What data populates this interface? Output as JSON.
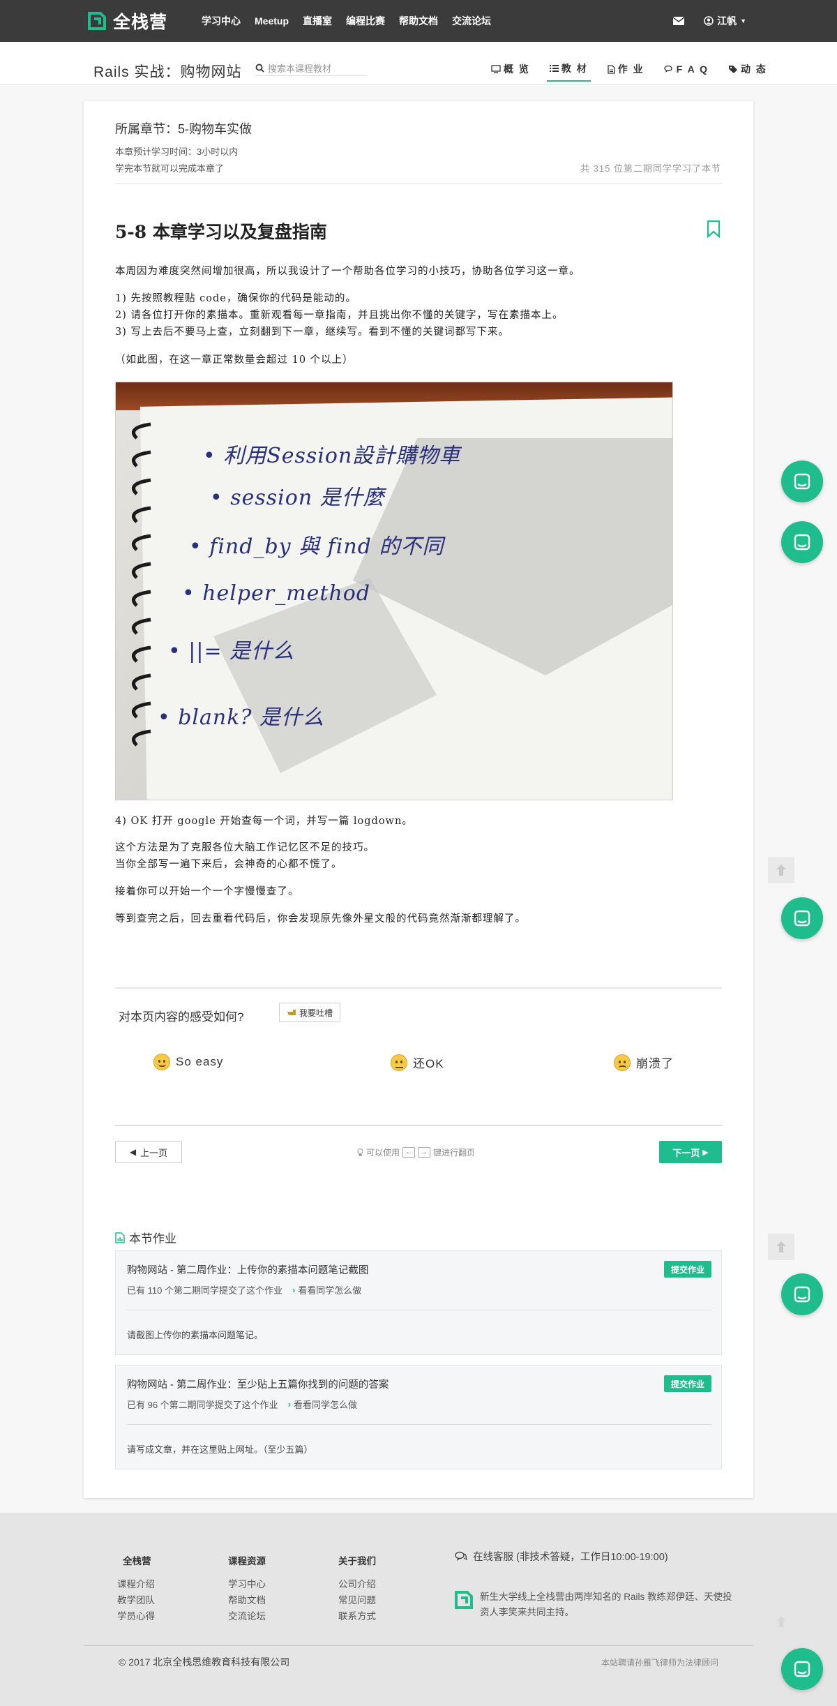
{
  "topbar": {
    "brand": "全栈营",
    "nav": [
      "学习中心",
      "Meetup",
      "直播室",
      "编程比赛",
      "帮助文档",
      "交流论坛"
    ],
    "user": "江帆"
  },
  "subbar": {
    "course_title": "Rails 实战：购物网站",
    "search_placeholder": "搜索本课程教材",
    "tabs": [
      {
        "label": "概 览",
        "icon": "monitor-icon",
        "active": false
      },
      {
        "label": "教 材",
        "icon": "list-icon",
        "active": true
      },
      {
        "label": "作 业",
        "icon": "file-icon",
        "active": false
      },
      {
        "label": "F A Q",
        "icon": "comments-icon",
        "active": false
      },
      {
        "label": "动 态",
        "icon": "tags-icon",
        "active": false
      }
    ]
  },
  "lesson": {
    "chapter": "所属章节：5-购物车实做",
    "estimate": "本章预计学习时间：3小时以内",
    "complete": "学完本节就可以完成本章了",
    "learners": "共 315 位第二期同学学习了本节",
    "title": "5-8 本章学习以及复盘指南",
    "intro": "本周因为难度突然间增加很高，所以我设计了一个帮助各位学习的小技巧，协助各位学习这一章。",
    "steps": [
      "1) 先按照教程贴 code，确保你的代码是能动的。",
      "2) 请各位打开你的素描本。重新观看每一章指南，并且挑出你不懂的关键字，写在素描本上。",
      "3) 写上去后不要马上查，立刻翻到下一章，继续写。看到不懂的关键词都写下来。"
    ],
    "note": "（如此图，在这一章正常数量会超过 10 个以上）",
    "photo_lines": [
      "• 利用Session設計購物車",
      "• session 是什麼",
      "• find_by 與 find 的不同",
      "• helper_method",
      "• ||= 是什么",
      "• blank? 是什么"
    ],
    "step4": "4) OK 打开 google 开始查每一个词，并写一篇 logdown。",
    "method1": "这个方法是为了克服各位大脑工作记忆区不足的技巧。",
    "method2": "当你全部写一遍下来后，会神奇的心都不慌了。",
    "next": "接着你可以开始一个一个字慢慢查了。",
    "ending": "等到查完之后，回去重看代码后，你会发现原先像外星文般的代码竟然渐渐都理解了。"
  },
  "rating": {
    "question": "对本页内容的感受如何?",
    "rant": "我要吐槽",
    "options": [
      "So easy",
      "还OK",
      "崩溃了"
    ]
  },
  "pager": {
    "prev": "上一页",
    "hint_before": "可以使用",
    "key_left": "←",
    "key_right": "→",
    "hint_after": "键进行翻页",
    "next": "下一页"
  },
  "homework": {
    "title": "本节作业",
    "items": [
      {
        "title": "购物网站 - 第二周作业：上传你的素描本问题笔记截图",
        "count": "已有 110 个第二期同学提交了这个作业",
        "see": "看看同学怎么做",
        "submit": "提交作业",
        "desc": "请截图上传你的素描本问题笔记。"
      },
      {
        "title": "购物网站 - 第二周作业：至少贴上五篇你找到的问题的答案",
        "count": "已有 96 个第二期同学提交了这个作业",
        "see": "看看同学怎么做",
        "submit": "提交作业",
        "desc": "请写成文章，并在这里贴上网址。（至少五篇）"
      }
    ]
  },
  "footer": {
    "cols": [
      {
        "head": "全栈营",
        "links": [
          "课程介绍",
          "教学团队",
          "学员心得"
        ]
      },
      {
        "head": "课程资源",
        "links": [
          "学习中心",
          "帮助文档",
          "交流论坛"
        ]
      },
      {
        "head": "关于我们",
        "links": [
          "公司介绍",
          "常见问题",
          "联系方式"
        ]
      }
    ],
    "service": "在线客服 (非技术答疑，工作日10:00-19:00)",
    "about": "新生大学线上全栈营由两岸知名的 Rails 教练郑伊廷、天使投资人李笑来共同主持。",
    "copyright": "© 2017 北京全栈思维教育科技有限公司",
    "legal": "本站聘请孙雁飞律师为法律顾问"
  },
  "colors": {
    "accent": "#1fbd8d",
    "topbar": "#3b3b3b"
  }
}
